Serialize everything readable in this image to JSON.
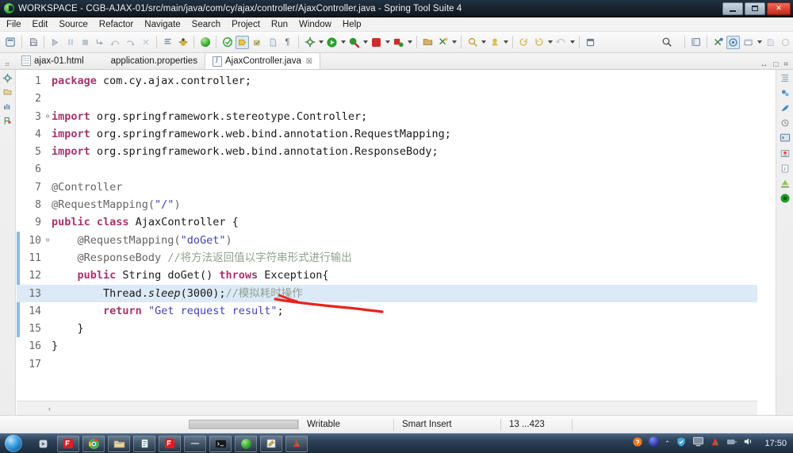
{
  "window": {
    "title": "WORKSPACE - CGB-AJAX-01/src/main/java/com/cy/ajax/controller/AjaxController.java - Spring Tool Suite 4",
    "app_icon": "spring-leaf-icon",
    "minimize_label": "—",
    "maximize_label": "□",
    "close_label": "✕"
  },
  "menubar": {
    "items": [
      {
        "label": "File"
      },
      {
        "label": "Edit"
      },
      {
        "label": "Source"
      },
      {
        "label": "Refactor"
      },
      {
        "label": "Navigate"
      },
      {
        "label": "Search"
      },
      {
        "label": "Project"
      },
      {
        "label": "Run"
      },
      {
        "label": "Window"
      },
      {
        "label": "Help"
      }
    ]
  },
  "toolbar": {
    "left_groups": [
      {
        "icons": [
          "new-wizard-icon"
        ]
      },
      {
        "icons": [
          "save-icon"
        ]
      },
      {
        "icons": [
          "resume-icon",
          "suspend-icon",
          "terminate-icon",
          "step-into-icon",
          "step-over-icon",
          "step-return-icon",
          "drop-to-frame-icon"
        ]
      },
      {
        "icons": [
          "open-task-icon",
          "debug-bug-icon"
        ]
      },
      {
        "icons": [
          "spring-boot-dashboard-icon",
          "spring-icon",
          "boot-run-icon",
          "validate-icon",
          "file-icon",
          "paragraph-icon"
        ]
      },
      {
        "icons": [
          "external-tools-icon",
          "run-icon",
          "debug-icon",
          "stop-icon",
          "coverage-icon"
        ]
      },
      {
        "icons": [
          "new-java-project-icon",
          "new-class-icon"
        ]
      },
      {
        "icons": [
          "search-folder-icon",
          "open-type-icon",
          "previous-edit-icon",
          "next-edit-icon",
          "back-icon",
          "forward-icon"
        ]
      },
      {
        "icons": [
          "pin-editor-icon"
        ]
      }
    ],
    "right_groups": [
      {
        "icons": [
          "quick-access-search-icon"
        ]
      },
      {
        "icons": [
          "open-perspective-icon",
          "java-perspective-icon",
          "debug-perspective-icon",
          "spring-perspective-icon"
        ]
      },
      {
        "icons": [
          "show-view-icon",
          "minimize-icon",
          "maximize-icon"
        ]
      }
    ]
  },
  "tabs": {
    "items": [
      {
        "label": "ajax-01.html",
        "icon": "html-file-icon",
        "active": false,
        "closeable": false
      },
      {
        "label": "application.properties",
        "icon": "properties-file-icon",
        "active": false,
        "closeable": false
      },
      {
        "label": "AjaxController.java",
        "icon": "java-file-icon",
        "active": true,
        "closeable": true,
        "close_glyph": "☒"
      }
    ],
    "right_controls": [
      {
        "icon": "restore-editor-icon",
        "glyph": "↔"
      },
      {
        "icon": "maximize-editor-icon",
        "glyph": "□"
      },
      {
        "icon": "editor-menu-icon",
        "glyph": "⚙"
      }
    ]
  },
  "left_rail": {
    "icons": [
      "outline-toggle-icon",
      "package-explorer-icon",
      "boot-dashboard-icon",
      "markers-icon"
    ]
  },
  "right_rail": {
    "icons": [
      "outline-view-icon",
      "task-list-icon",
      "spring-explorer-icon",
      "history-icon",
      "console-icon",
      "problems-icon",
      "javadoc-icon",
      "terminal-icon",
      "server-icon"
    ]
  },
  "editor": {
    "highlighted_line": 13,
    "changed_line_range": {
      "from": 10,
      "to": 15
    },
    "lines": [
      {
        "num": "1",
        "fold": "",
        "tokens": [
          {
            "t": "package",
            "c": "kw"
          },
          {
            "t": " com.cy.ajax.controller;",
            "c": "plain"
          }
        ]
      },
      {
        "num": "2",
        "fold": "",
        "tokens": []
      },
      {
        "num": "3",
        "fold": "⊕",
        "tokens": [
          {
            "t": "import",
            "c": "kw"
          },
          {
            "t": " org.springframework.stereotype.Controller;",
            "c": "plain"
          }
        ]
      },
      {
        "num": "4",
        "fold": "",
        "tokens": [
          {
            "t": "import",
            "c": "kw"
          },
          {
            "t": " org.springframework.web.bind.annotation.RequestMapping;",
            "c": "plain"
          }
        ]
      },
      {
        "num": "5",
        "fold": "",
        "tokens": [
          {
            "t": "import",
            "c": "kw"
          },
          {
            "t": " org.springframework.web.bind.annotation.ResponseBody;",
            "c": "plain"
          }
        ]
      },
      {
        "num": "6",
        "fold": "",
        "tokens": []
      },
      {
        "num": "7",
        "fold": "",
        "tokens": [
          {
            "t": "@Controller",
            "c": "ann"
          }
        ]
      },
      {
        "num": "8",
        "fold": "",
        "tokens": [
          {
            "t": "@RequestMapping(",
            "c": "ann"
          },
          {
            "t": "\"/\"",
            "c": "str"
          },
          {
            "t": ")",
            "c": "ann"
          }
        ]
      },
      {
        "num": "9",
        "fold": "",
        "tokens": [
          {
            "t": "public class",
            "c": "kw"
          },
          {
            "t": " AjaxController {",
            "c": "plain"
          }
        ]
      },
      {
        "num": "10",
        "fold": "⊕",
        "tokens": [
          {
            "t": "    @RequestMapping(",
            "c": "ann"
          },
          {
            "t": "\"doGet\"",
            "c": "str"
          },
          {
            "t": ")",
            "c": "ann"
          }
        ]
      },
      {
        "num": "11",
        "fold": "",
        "tokens": [
          {
            "t": "    @ResponseBody ",
            "c": "ann"
          },
          {
            "t": "//将方法返回值以字符串形式进行输出",
            "c": "cmt"
          }
        ]
      },
      {
        "num": "12",
        "fold": "",
        "tokens": [
          {
            "t": "    ",
            "c": "plain"
          },
          {
            "t": "public",
            "c": "kw"
          },
          {
            "t": " String doGet() ",
            "c": "plain"
          },
          {
            "t": "throws",
            "c": "kw"
          },
          {
            "t": " Exception{",
            "c": "plain"
          }
        ]
      },
      {
        "num": "13",
        "fold": "",
        "tokens": [
          {
            "t": "        Thread.",
            "c": "plain"
          },
          {
            "t": "sleep",
            "c": "ital"
          },
          {
            "t": "(3000);",
            "c": "plain"
          },
          {
            "t": "//模拟耗时操作",
            "c": "cmt"
          }
        ]
      },
      {
        "num": "14",
        "fold": "",
        "tokens": [
          {
            "t": "        ",
            "c": "plain"
          },
          {
            "t": "return",
            "c": "kw"
          },
          {
            "t": " ",
            "c": "plain"
          },
          {
            "t": "\"Get request result\"",
            "c": "str"
          },
          {
            "t": ";",
            "c": "plain"
          }
        ]
      },
      {
        "num": "15",
        "fold": "",
        "tokens": [
          {
            "t": "    }",
            "c": "plain"
          }
        ]
      },
      {
        "num": "16",
        "fold": "",
        "tokens": [
          {
            "t": "}",
            "c": "plain"
          }
        ]
      },
      {
        "num": "17",
        "fold": "",
        "tokens": []
      }
    ],
    "annotation": {
      "type": "red-underline-stroke",
      "color": "#e8231c"
    },
    "h_scroll_left_glyph": "‹"
  },
  "statusbar": {
    "writable": "Writable",
    "insert_mode": "Smart Insert",
    "cursor_position": "13 ...423"
  },
  "taskbar": {
    "start_label": "start-orb-icon",
    "apps": [
      {
        "icon": "media-player-icon"
      },
      {
        "icon": "foxit-reader-icon"
      },
      {
        "icon": "chrome-icon"
      },
      {
        "icon": "explorer-icon"
      },
      {
        "icon": "notepad-icon"
      },
      {
        "icon": "foxit-icon"
      },
      {
        "icon": "minimized-window-icon"
      },
      {
        "icon": "terminal-icon"
      },
      {
        "icon": "sts-icon"
      },
      {
        "icon": "editplus-icon"
      },
      {
        "icon": "wps-icon"
      }
    ],
    "tray": [
      {
        "icon": "sogou-input-icon"
      },
      {
        "icon": "ie-icon"
      },
      {
        "icon": "show-hidden-icons-icon"
      },
      {
        "icon": "security-shield-icon"
      },
      {
        "icon": "network-monitor-icon"
      },
      {
        "icon": "antivirus-icon"
      },
      {
        "icon": "eject-icon"
      },
      {
        "icon": "volume-icon"
      }
    ],
    "clock": "17:50"
  },
  "colors": {
    "titlebar_bg": "#16202b",
    "accent_blue": "#8fbbdc",
    "highlight_line": "#dce9f6",
    "keyword": "#a8336b",
    "string": "#3f3fbf",
    "comment": "#8fa38f",
    "annotation_red": "#e8231c"
  }
}
